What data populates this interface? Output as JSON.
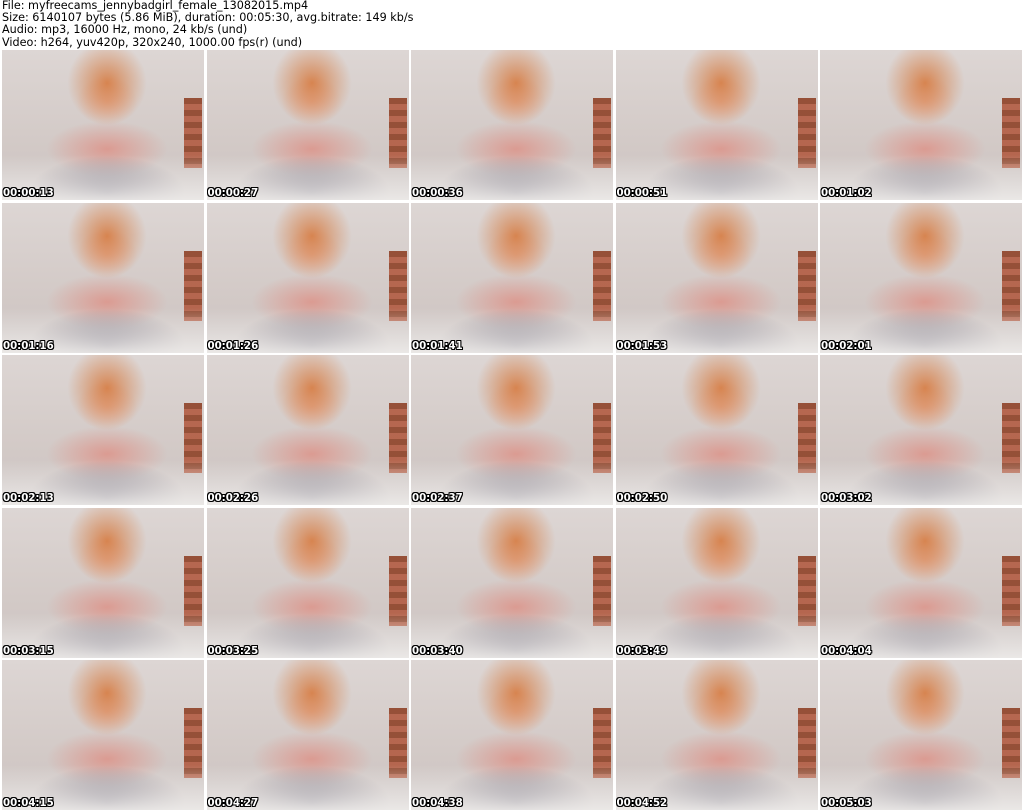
{
  "header": {
    "file": "File: myfreecams_jennybadgirl_female_13082015.mp4",
    "size": "Size: 6140107 bytes (5.86 MiB), duration: 00:05:30, avg.bitrate: 149 kb/s",
    "audio": "Audio: mp3, 16000 Hz, mono, 24 kb/s (und)",
    "video": "Video: h264, yuv420p, 320x240, 1000.00 fps(r) (und)"
  },
  "thumbnails": [
    {
      "timestamp": "00:00:13"
    },
    {
      "timestamp": "00:00:27"
    },
    {
      "timestamp": "00:00:36"
    },
    {
      "timestamp": "00:00:51"
    },
    {
      "timestamp": "00:01:02"
    },
    {
      "timestamp": "00:01:16"
    },
    {
      "timestamp": "00:01:26"
    },
    {
      "timestamp": "00:01:41"
    },
    {
      "timestamp": "00:01:53"
    },
    {
      "timestamp": "00:02:01"
    },
    {
      "timestamp": "00:02:13"
    },
    {
      "timestamp": "00:02:26"
    },
    {
      "timestamp": "00:02:37"
    },
    {
      "timestamp": "00:02:50"
    },
    {
      "timestamp": "00:03:02"
    },
    {
      "timestamp": "00:03:15"
    },
    {
      "timestamp": "00:03:25"
    },
    {
      "timestamp": "00:03:40"
    },
    {
      "timestamp": "00:03:49"
    },
    {
      "timestamp": "00:04:04"
    },
    {
      "timestamp": "00:04:15"
    },
    {
      "timestamp": "00:04:27"
    },
    {
      "timestamp": "00:04:38"
    },
    {
      "timestamp": "00:04:52"
    },
    {
      "timestamp": "00:05:03"
    }
  ]
}
